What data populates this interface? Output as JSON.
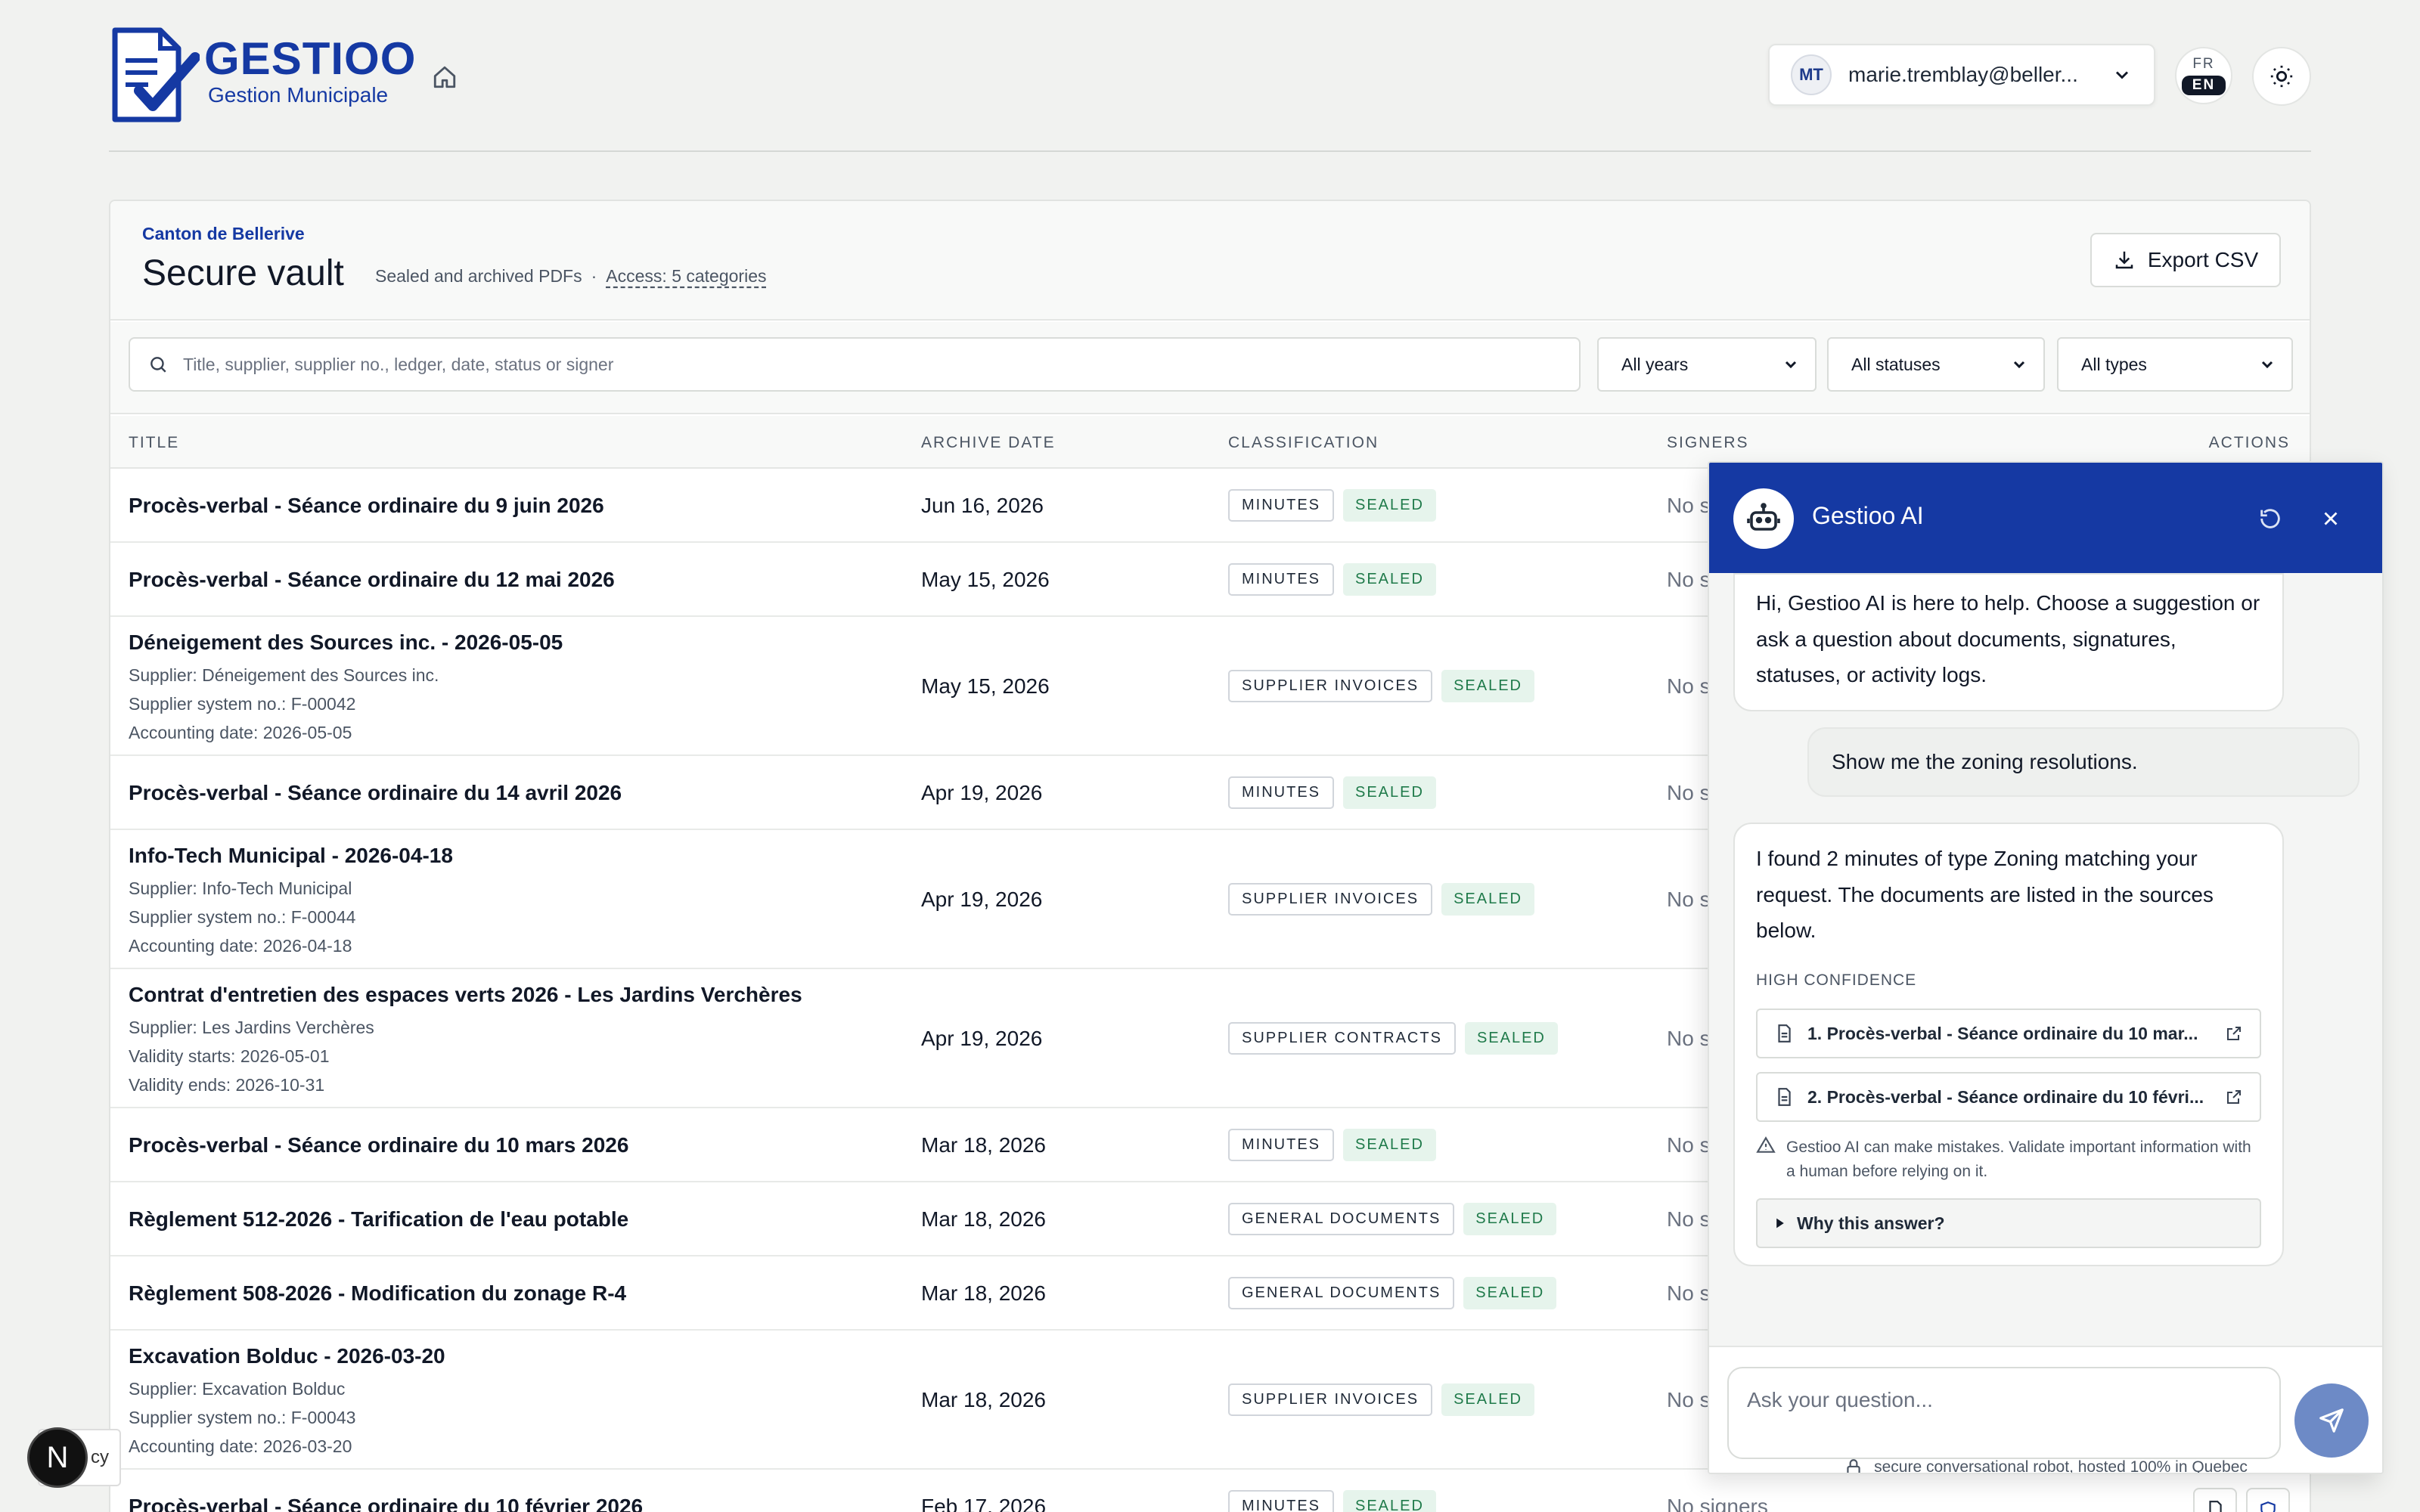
{
  "header": {
    "brand_name": "GESTIOO",
    "brand_sub": "Gestion Municipale",
    "user_initials": "MT",
    "user_email": "marie.tremblay@beller...",
    "lang_fr": "FR",
    "lang_en": "EN"
  },
  "vault": {
    "org": "Canton de Bellerive",
    "title": "Secure vault",
    "desc": "Sealed and archived PDFs",
    "dot": "·",
    "access": "Access: 5 categories",
    "export_label": "Export CSV"
  },
  "filters": {
    "search_placeholder": "Title, supplier, supplier no., ledger, date, status or signer",
    "years": "All years",
    "statuses": "All statuses",
    "types": "All types"
  },
  "table": {
    "columns": [
      "TITLE",
      "ARCHIVE DATE",
      "CLASSIFICATION",
      "SIGNERS",
      "ACTIONS"
    ],
    "rows": [
      {
        "title": "Procès-verbal - Séance ordinaire du 9 juin 2026",
        "meta": [],
        "date": "Jun 16, 2026",
        "type": "MINUTES",
        "status": "SEALED",
        "signers": "No s"
      },
      {
        "title": "Procès-verbal - Séance ordinaire du 12 mai 2026",
        "meta": [],
        "date": "May 15, 2026",
        "type": "MINUTES",
        "status": "SEALED",
        "signers": "No s"
      },
      {
        "title": "Déneigement des Sources inc. - 2026-05-05",
        "meta": [
          "Supplier: Déneigement des Sources inc.",
          "Supplier system no.: F-00042",
          "Accounting date: 2026-05-05"
        ],
        "date": "May 15, 2026",
        "type": "SUPPLIER INVOICES",
        "status": "SEALED",
        "signers": "No s"
      },
      {
        "title": "Procès-verbal - Séance ordinaire du 14 avril 2026",
        "meta": [],
        "date": "Apr 19, 2026",
        "type": "MINUTES",
        "status": "SEALED",
        "signers": "No s"
      },
      {
        "title": "Info-Tech Municipal - 2026-04-18",
        "meta": [
          "Supplier: Info-Tech Municipal",
          "Supplier system no.: F-00044",
          "Accounting date: 2026-04-18"
        ],
        "date": "Apr 19, 2026",
        "type": "SUPPLIER INVOICES",
        "status": "SEALED",
        "signers": "No s"
      },
      {
        "title": "Contrat d'entretien des espaces verts 2026 - Les Jardins Verchères",
        "meta": [
          "Supplier: Les Jardins Verchères",
          "Validity starts: 2026-05-01",
          "Validity ends: 2026-10-31"
        ],
        "date": "Apr 19, 2026",
        "type": "SUPPLIER CONTRACTS",
        "status": "SEALED",
        "signers": "No s"
      },
      {
        "title": "Procès-verbal - Séance ordinaire du 10 mars 2026",
        "meta": [],
        "date": "Mar 18, 2026",
        "type": "MINUTES",
        "status": "SEALED",
        "signers": "No s"
      },
      {
        "title": "Règlement 512-2026 - Tarification de l'eau potable",
        "meta": [],
        "date": "Mar 18, 2026",
        "type": "GENERAL DOCUMENTS",
        "status": "SEALED",
        "signers": "No s"
      },
      {
        "title": "Règlement 508-2026 - Modification du zonage R-4",
        "meta": [],
        "date": "Mar 18, 2026",
        "type": "GENERAL DOCUMENTS",
        "status": "SEALED",
        "signers": "No s"
      },
      {
        "title": "Excavation Bolduc - 2026-03-20",
        "meta": [
          "Supplier: Excavation Bolduc",
          "Supplier system no.: F-00043",
          "Accounting date: 2026-03-20"
        ],
        "date": "Mar 18, 2026",
        "type": "SUPPLIER INVOICES",
        "status": "SEALED",
        "signers": "No s"
      },
      {
        "title": "Procès-verbal - Séance ordinaire du 10 février 2026",
        "meta": [],
        "date": "Feb 17, 2026",
        "type": "MINUTES",
        "status": "SEALED",
        "signers": "No signers"
      }
    ]
  },
  "ai": {
    "name": "Gestioo AI",
    "greeting": "Hi, Gestioo AI is here to help. Choose a suggestion or ask a question about documents, signatures, statuses, or activity logs.",
    "user_message": "Show me the zoning resolutions.",
    "answer": "I found 2 minutes of type Zoning matching your request. The documents are listed in the sources below.",
    "confidence": "HIGH CONFIDENCE",
    "sources": [
      "1. Procès-verbal - Séance ordinaire du 10 mar...",
      "2. Procès-verbal - Séance ordinaire du 10 févri..."
    ],
    "warning": "Gestioo AI can make mistakes. Validate important information with a human before relying on it.",
    "why_label": "Why this answer?",
    "ask_placeholder": "Ask your question...",
    "secure_note": "secure conversational robot, hosted 100% in Quebec"
  },
  "misc": {
    "next_badge": "N",
    "privacy_tag": "cy"
  }
}
